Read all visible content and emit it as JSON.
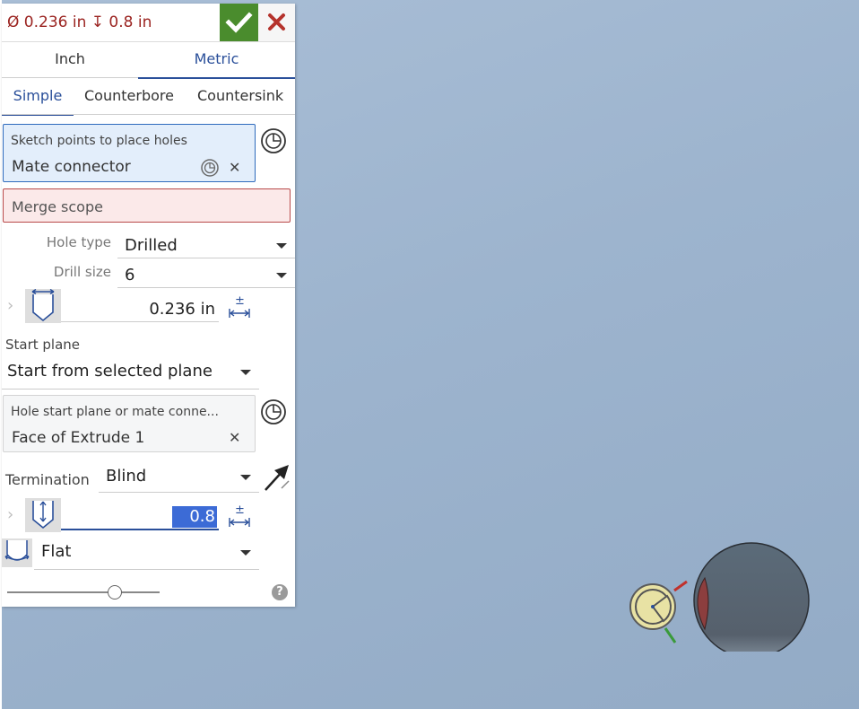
{
  "header": {
    "summary": "Ø 0.236 in ↧ 0.8 in"
  },
  "units": {
    "inch_label": "Inch",
    "metric_label": "Metric"
  },
  "styles": {
    "simple_label": "Simple",
    "counterbore_label": "Counterbore",
    "countersink_label": "Countersink"
  },
  "sketch_points": {
    "title": "Sketch points to place holes",
    "value": "Mate connector"
  },
  "merge_scope": {
    "label": "Merge scope"
  },
  "hole_type": {
    "label": "Hole type",
    "value": "Drilled"
  },
  "drill_size": {
    "label": "Drill size",
    "value": "6"
  },
  "diameter": {
    "value": "0.236 in",
    "tolerance_glyph": "±"
  },
  "start_plane": {
    "label": "Start plane",
    "value": "Start from selected plane"
  },
  "start_plane_selection": {
    "title": "Hole start plane or mate conne...",
    "value": "Face of Extrude 1"
  },
  "termination": {
    "label": "Termination",
    "value": "Blind"
  },
  "depth": {
    "value": "0.8 in",
    "tolerance_glyph": "±"
  },
  "tip": {
    "value": "Flat"
  },
  "slider": {
    "level": 0.7
  },
  "help": {
    "glyph": "?"
  },
  "colors": {
    "accent": "#2a4f9a",
    "ok": "#4a8c2d",
    "error": "#9b2421",
    "selection": "#3c6bd6"
  }
}
